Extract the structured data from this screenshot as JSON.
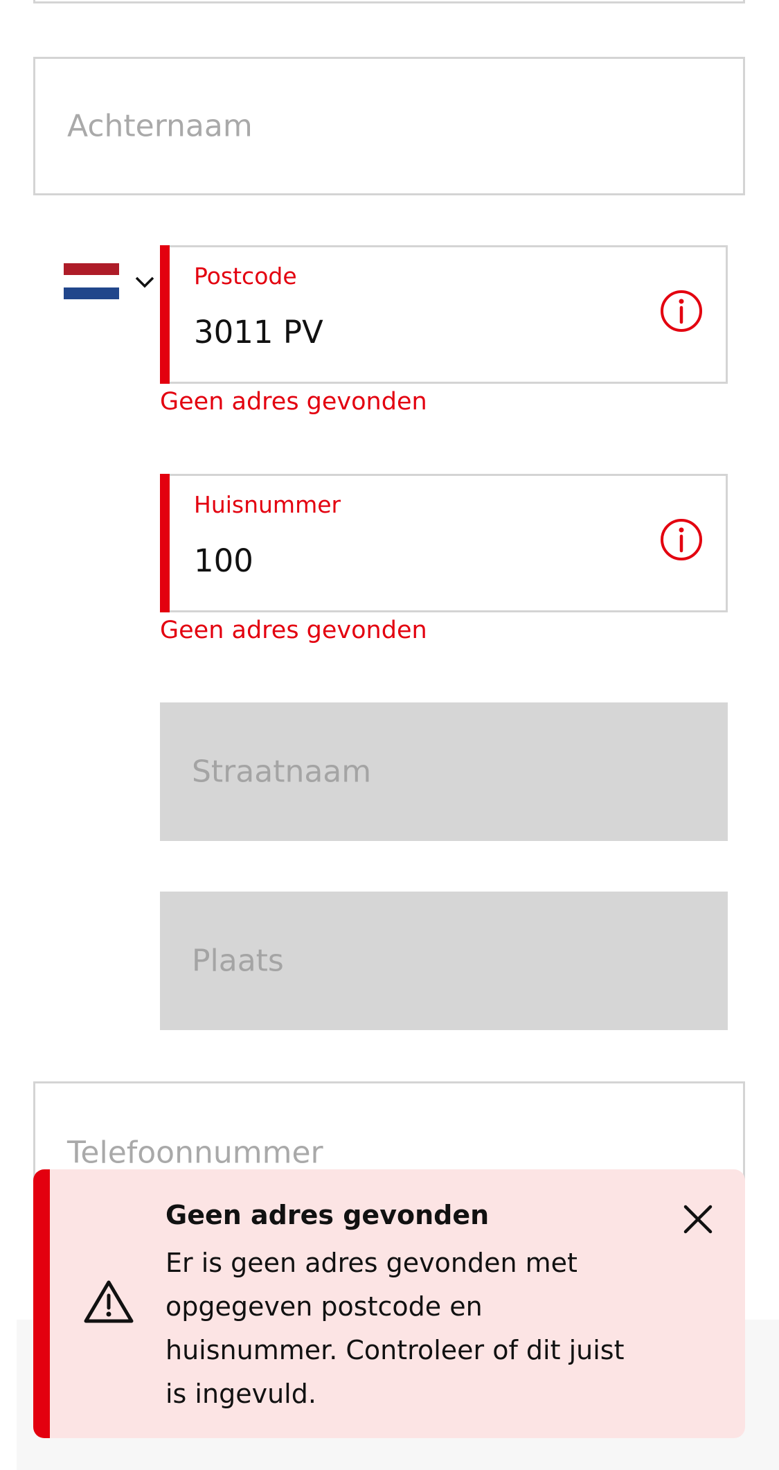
{
  "form": {
    "achternaam": {
      "placeholder": "Achternaam"
    },
    "country": {
      "flag": "netherlands-flag",
      "flag_colors": [
        "#ae1c28",
        "#ffffff",
        "#21468b"
      ]
    },
    "postcode": {
      "label": "Postcode",
      "value": "3011 PV",
      "error": "Geen adres gevonden"
    },
    "huisnummer": {
      "label": "Huisnummer",
      "value": "100",
      "error": "Geen adres gevonden"
    },
    "straatnaam": {
      "placeholder": "Straatnaam"
    },
    "plaats": {
      "placeholder": "Plaats"
    },
    "telefoonnummer": {
      "placeholder": "Telefoonnummer"
    }
  },
  "toast": {
    "title": "Geen adres gevonden",
    "message": "Er is geen adres gevonden met opgegeven postcode en huisnummer. Controleer of dit juist is ingevuld."
  },
  "colors": {
    "error": "#e3000f",
    "toast_bg": "#fce4e4",
    "disabled_bg": "#d6d6d6",
    "border": "#d4d4d4"
  }
}
